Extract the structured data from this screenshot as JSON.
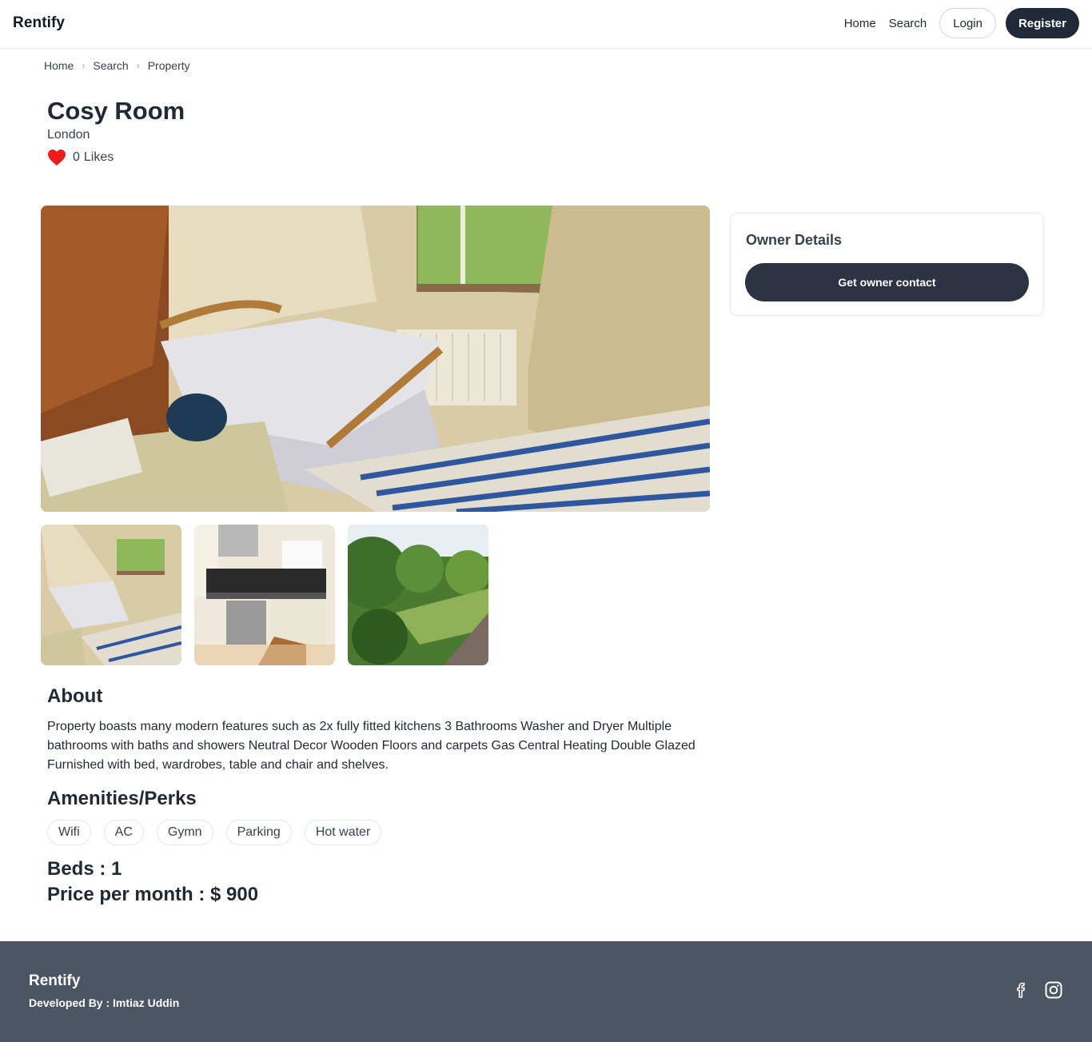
{
  "navbar": {
    "brand": "Rentify",
    "links": [
      "Home",
      "Search"
    ],
    "login_label": "Login",
    "register_label": "Register"
  },
  "breadcrumb": [
    "Home",
    "Search",
    "Property"
  ],
  "property": {
    "title": "Cosy Room",
    "location": "London",
    "likes_count": "0",
    "likes_label": "Likes",
    "about_heading": "About",
    "about_text": "Property boasts many modern features such as 2x fully fitted kitchens 3 Bathrooms Washer and Dryer Multiple bathrooms with baths and showers Neutral Decor Wooden Floors and carpets Gas Central Heating Double Glazed Furnished with bed, wardrobes, table and chair and shelves.",
    "amenities_heading": "Amenities/Perks",
    "amenities": [
      "Wifi",
      "AC",
      "Gymn",
      "Parking",
      "Hot water"
    ],
    "beds_text": "Beds : 1",
    "price_text": "Price per month : $ 900"
  },
  "owner": {
    "heading": "Owner Details",
    "contact_button": "Get owner contact"
  },
  "footer": {
    "brand": "Rentify",
    "developer_text": "Developed By : Imtiaz Uddin",
    "social_icons": [
      "facebook-icon",
      "instagram-icon"
    ]
  },
  "colors": {
    "primary_dark": "#1f2937",
    "owner_button": "#2d3342",
    "footer_bg": "#4b5563",
    "heart": "#ef1c1c"
  }
}
